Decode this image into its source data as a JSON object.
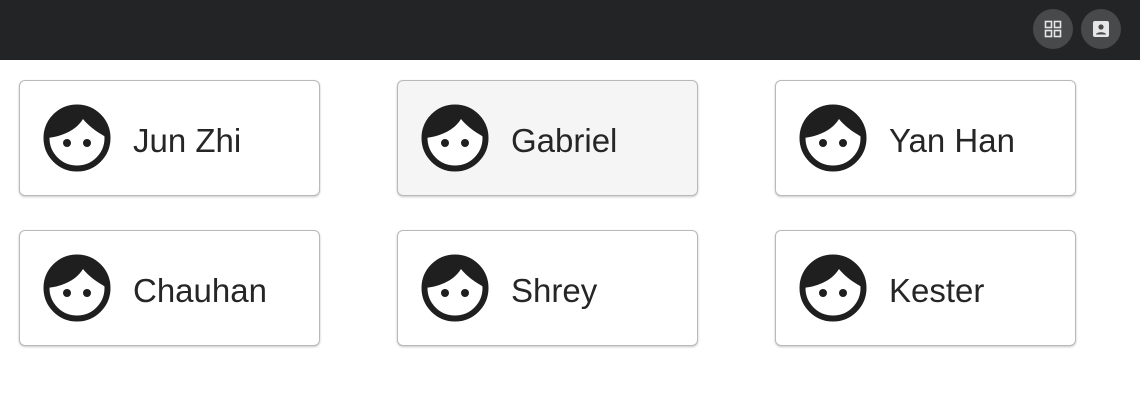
{
  "header": {
    "background": "#232426",
    "actions": [
      {
        "icon": "grid-view-icon"
      },
      {
        "icon": "contact-card-icon"
      }
    ]
  },
  "people": [
    {
      "name": "Jun Zhi",
      "avatar": "face-icon",
      "selected": false
    },
    {
      "name": "Gabriel",
      "avatar": "face-icon",
      "selected": true
    },
    {
      "name": "Yan Han",
      "avatar": "face-icon",
      "selected": false
    },
    {
      "name": "Chauhan",
      "avatar": "face-icon",
      "selected": false
    },
    {
      "name": "Shrey",
      "avatar": "face-icon",
      "selected": false
    },
    {
      "name": "Kester",
      "avatar": "face-icon",
      "selected": false
    }
  ],
  "colors": {
    "card_selected_background": "#f5f5f5",
    "card_border": "#b9b9b9",
    "text": "#262626"
  }
}
